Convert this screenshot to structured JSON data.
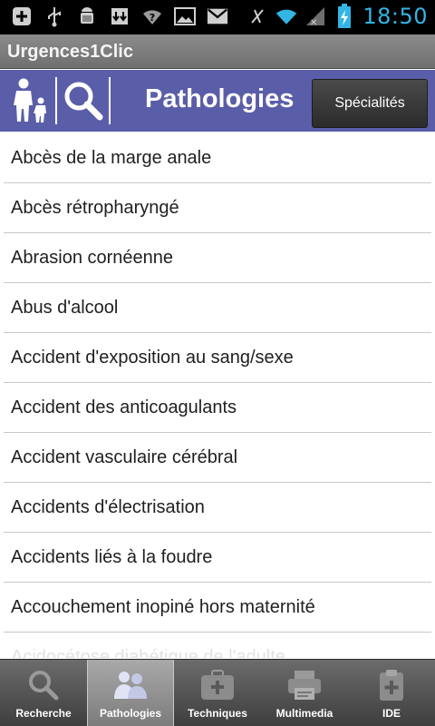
{
  "status_bar": {
    "time": "18:50",
    "icons": [
      "add-notification-icon",
      "usb-icon",
      "android-debug-icon",
      "download-icon",
      "wifi-question-icon",
      "image-icon",
      "gmail-icon",
      "vibrate-off-icon",
      "wifi-icon",
      "signal-icon",
      "battery-charging-icon"
    ]
  },
  "app": {
    "title": "Urgences1Clic"
  },
  "header": {
    "title": "Pathologies",
    "specialites_label": "Spécialités",
    "people_icon": "family-icon",
    "search_icon": "search-icon",
    "color": "#5a5ea8"
  },
  "list": {
    "items": [
      "Abcès de la marge anale",
      "Abcès rétropharyngé",
      "Abrasion cornéenne",
      "Abus d'alcool",
      "Accident d'exposition au sang/sexe",
      "Accident des anticoagulants",
      "Accident vasculaire cérébral",
      "Accidents d'électrisation",
      "Accidents liés à  la foudre",
      "Accouchement inopiné hors maternité",
      "Acidocétose diabétique de l'adulte"
    ]
  },
  "tabs": [
    {
      "label": "Recherche",
      "icon": "magnifier-icon",
      "active": false
    },
    {
      "label": "Pathologies",
      "icon": "people-icon",
      "active": true
    },
    {
      "label": "Techniques",
      "icon": "medical-bag-icon",
      "active": false
    },
    {
      "label": "Multimedia",
      "icon": "printer-icon",
      "active": false
    },
    {
      "label": "IDE",
      "icon": "clipboard-plus-icon",
      "active": false
    }
  ]
}
